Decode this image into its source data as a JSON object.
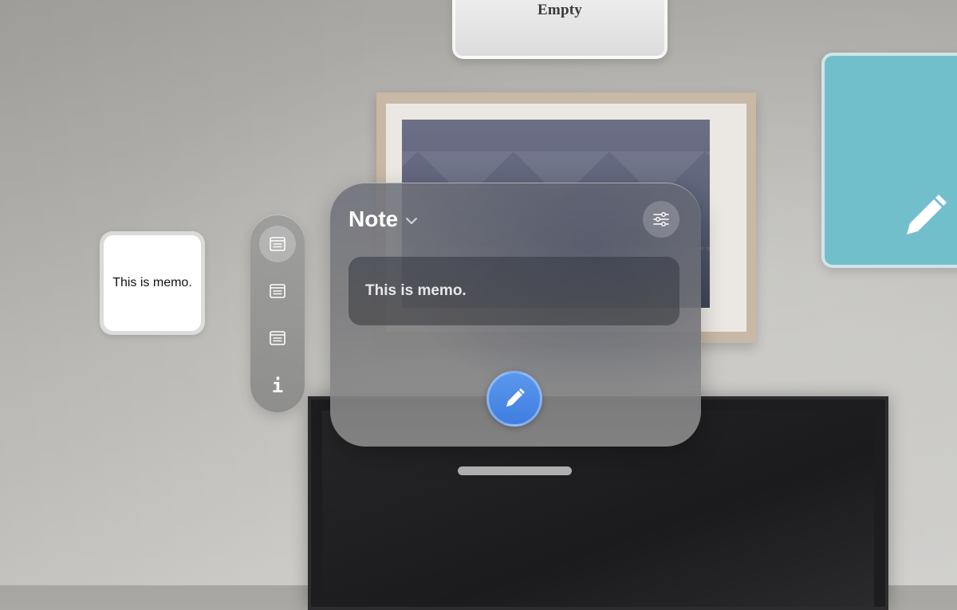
{
  "top_widget": {
    "text": "Empty"
  },
  "memo_widget": {
    "text": "This is memo."
  },
  "teal_widget": {
    "color": "#72bfcc",
    "icon": "pencil-icon"
  },
  "ornament": {
    "items": [
      {
        "icon": "note-icon",
        "active": true
      },
      {
        "icon": "note-icon",
        "active": false
      },
      {
        "icon": "note-icon",
        "active": false
      },
      {
        "icon": "info-icon",
        "label": "i",
        "active": false
      }
    ]
  },
  "window": {
    "title": "Note",
    "title_icon": "chevron-down-icon",
    "settings_icon": "sliders-icon",
    "memo_text": "This is memo.",
    "compose_icon": "pencil-icon",
    "accent_color": "#4a88e6"
  }
}
